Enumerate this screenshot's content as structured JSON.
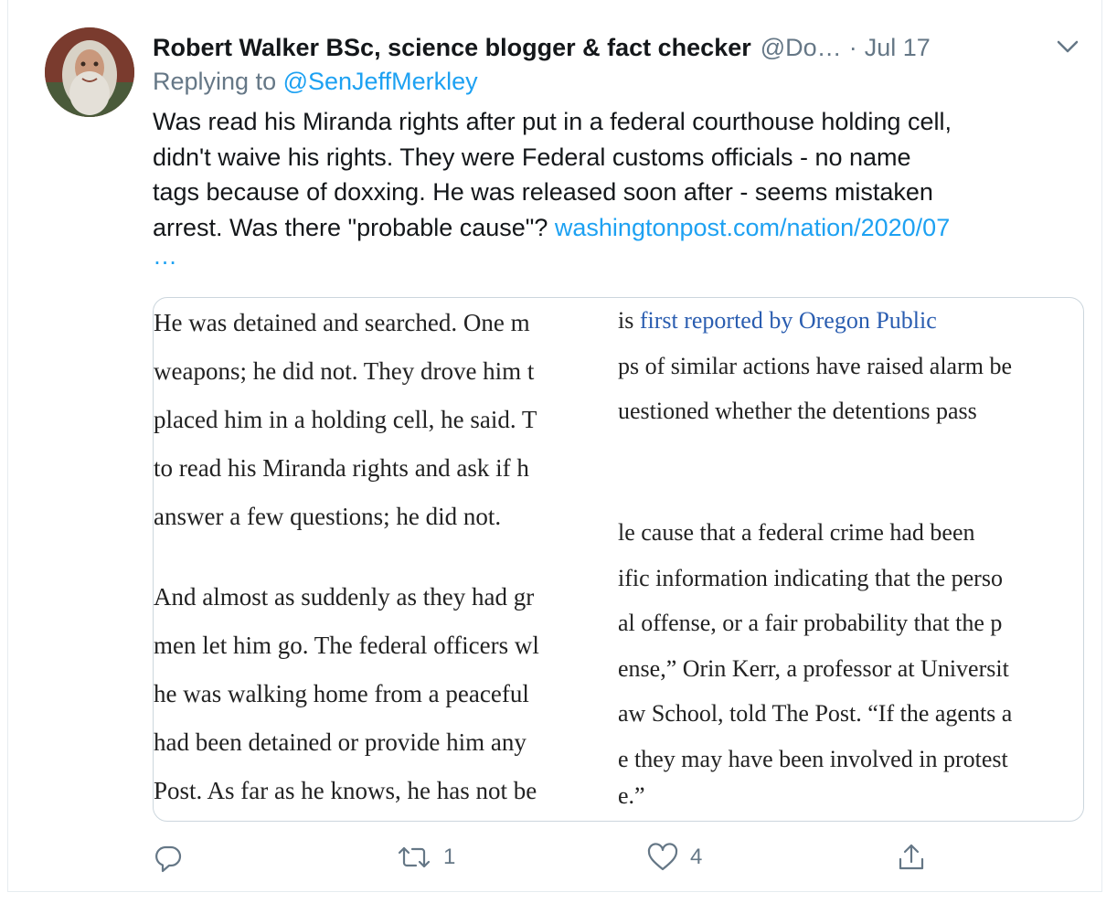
{
  "tweet": {
    "author_name": "Robert Walker BSc, science blogger & fact checker",
    "author_handle": "@Do…",
    "separator": "·",
    "date": "Jul 17",
    "replying_prefix": "Replying to",
    "replying_to": "@SenJeffMerkley",
    "text_lines": [
      "Was read his Miranda rights after put in a federal courthouse holding cell,",
      "didn't waive his rights. They were Federal customs officials - no name",
      "tags because of doxxing. He was released soon after - seems mistaken",
      "arrest. Was there \"probable cause\"?"
    ],
    "link_text": "washingtonpost.com/nation/2020/07",
    "link_ellipsis": "…"
  },
  "media": {
    "left_lines": [
      "He was detained and searched. One m",
      "weapons; he did not. They drove him t",
      "placed him in a holding cell, he said. T",
      "to read his Miranda rights and ask if h",
      "answer a few questions; he did not.",
      "And almost as suddenly as they had gr",
      "men let him go. The federal officers wl",
      "he was walking home from a peaceful ",
      "had been detained or provide him any",
      "Post. As far as he knows, he has not be"
    ],
    "right_top_prefix": "is ",
    "right_top_link": "first reported by Oregon Public",
    "right_lines": [
      "ps of similar actions have raised alarm be",
      "uestioned whether the detentions pass",
      "le cause that a federal crime had been",
      "ific information indicating that the perso",
      "al offense, or a fair probability that the p",
      "ense,” Orin Kerr, a professor at Universit",
      "aw School, told The Post. “If the agents a",
      "e they may have been involved in protest",
      "e.”"
    ]
  },
  "actions": {
    "reply_count": "",
    "retweet_count": "1",
    "like_count": "4"
  },
  "icons": {
    "caret": "chevron-down-icon",
    "reply": "reply-icon",
    "retweet": "retweet-icon",
    "like": "heart-icon",
    "share": "share-icon"
  },
  "colors": {
    "link": "#1da1f2",
    "secondary_text": "#657786",
    "article_link": "#2a5db0"
  }
}
